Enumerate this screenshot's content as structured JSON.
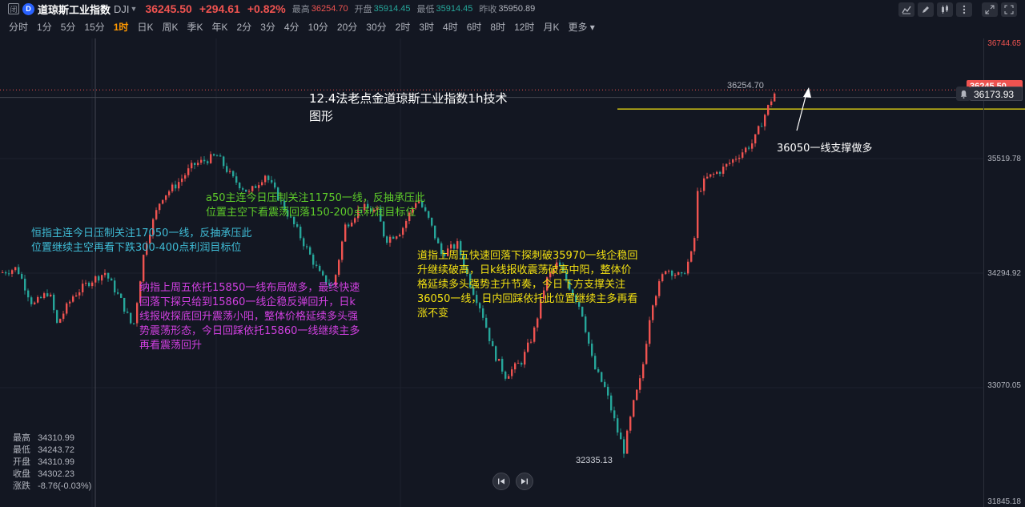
{
  "header": {
    "badge": "闭",
    "logo": "D",
    "title": "道琼斯工业指数",
    "symbol": "DJI",
    "price": "36245.50",
    "change": "+294.61",
    "change_pct": "+0.82%",
    "high_label": "最高",
    "high": "36254.70",
    "open_label": "开盘",
    "open": "35914.45",
    "low_label": "最低",
    "low": "35914.45",
    "prev_label": "昨收",
    "prev": "35950.89"
  },
  "toolbar": {
    "icons": [
      "indicator-icon",
      "draw-pen-icon",
      "candle-type-icon",
      "settings-dots-icon",
      "expand-icon",
      "fullscreen-icon"
    ]
  },
  "intervals": [
    "分时",
    "1分",
    "5分",
    "15分",
    "1时",
    "日K",
    "周K",
    "季K",
    "年K",
    "2分",
    "3分",
    "4分",
    "10分",
    "20分",
    "30分",
    "2时",
    "3时",
    "4时",
    "6时",
    "8时",
    "12时",
    "月K",
    "更多"
  ],
  "active_interval": "1时",
  "price_axis": {
    "labels": [
      "36744.65",
      "35519.78",
      "34294.92",
      "33070.05",
      "31845.18"
    ],
    "last_price_tag": "36245.50",
    "crosshair_tag": "36173.93"
  },
  "marks": {
    "period_high": "36254.70",
    "period_low": "32335.13"
  },
  "annotations": {
    "title": "12.4法老点金道琼斯工业指数1h技术\n图形",
    "hsi": "恒指主连今日压制关注17050一线，反抽承压此\n位置继续主空再看下跌300-400点利润目标位",
    "a50": "a50主连今日压制关注11750一线，反抽承压此\n位置主空下看震荡回落150-200点利润目标位",
    "nasdaq": "纳指上周五依托15850一线布局做多，最终快速\n回落下探只给到15860一线企稳反弹回升，日k\n线报收探底回升震荡小阳，整体价格延续多头强\n势震荡形态，今日回踩依托15860一线继续主多\n再看震荡回升",
    "dow": "道指上周五快速回落下探刺破35970一线企稳回\n升继续破高，日k线报收震荡破高中阳，整体价\n格延续多头强势主升节奏，今日下方支撑关注\n36050一线，日内回踩依托此位置继续主多再看\n涨不变",
    "support": "36050一线支撑做多"
  },
  "ohlc_panel": {
    "high_label": "最高",
    "high": "34310.99",
    "low_label": "最低",
    "low": "34243.72",
    "open_label": "开盘",
    "open": "34310.99",
    "close_label": "收盘",
    "close": "34302.23",
    "change_label": "涨跌",
    "change": "-8.76(-0.03%)"
  },
  "colors": {
    "up": "#ef5350",
    "down": "#26a69a",
    "support_line": "#f2e012",
    "background": "#131722"
  },
  "chart_data": {
    "type": "candlestick",
    "ylim": [
      31845.18,
      36744.65
    ],
    "anchors": [
      [
        0,
        34300
      ],
      [
        20,
        34350
      ],
      [
        40,
        33950
      ],
      [
        60,
        34100
      ],
      [
        70,
        33750
      ],
      [
        90,
        34050
      ],
      [
        110,
        34200
      ],
      [
        130,
        34300
      ],
      [
        150,
        34000
      ],
      [
        165,
        33700
      ],
      [
        180,
        34600
      ],
      [
        200,
        35100
      ],
      [
        220,
        35250
      ],
      [
        240,
        35450
      ],
      [
        270,
        35550
      ],
      [
        290,
        35300
      ],
      [
        310,
        35150
      ],
      [
        330,
        35350
      ],
      [
        350,
        35050
      ],
      [
        370,
        34750
      ],
      [
        385,
        34500
      ],
      [
        400,
        34250
      ],
      [
        415,
        34150
      ],
      [
        430,
        34800
      ],
      [
        450,
        35000
      ],
      [
        470,
        34950
      ],
      [
        480,
        34650
      ],
      [
        500,
        34750
      ],
      [
        520,
        35100
      ],
      [
        535,
        34850
      ],
      [
        550,
        34500
      ],
      [
        570,
        34600
      ],
      [
        585,
        34200
      ],
      [
        600,
        33900
      ],
      [
        615,
        33450
      ],
      [
        630,
        33200
      ],
      [
        650,
        33350
      ],
      [
        665,
        33650
      ],
      [
        680,
        34200
      ],
      [
        695,
        34400
      ],
      [
        710,
        34150
      ],
      [
        725,
        33900
      ],
      [
        740,
        33300
      ],
      [
        755,
        33050
      ],
      [
        770,
        32600
      ],
      [
        778,
        32400
      ],
      [
        790,
        32900
      ],
      [
        800,
        33200
      ],
      [
        812,
        33950
      ],
      [
        830,
        34350
      ],
      [
        850,
        34250
      ],
      [
        865,
        34550
      ],
      [
        870,
        35150
      ],
      [
        880,
        35300
      ],
      [
        900,
        35400
      ],
      [
        920,
        35550
      ],
      [
        940,
        35700
      ],
      [
        952,
        35950
      ],
      [
        962,
        36150
      ],
      [
        968,
        36250
      ]
    ],
    "support": 36050
  }
}
